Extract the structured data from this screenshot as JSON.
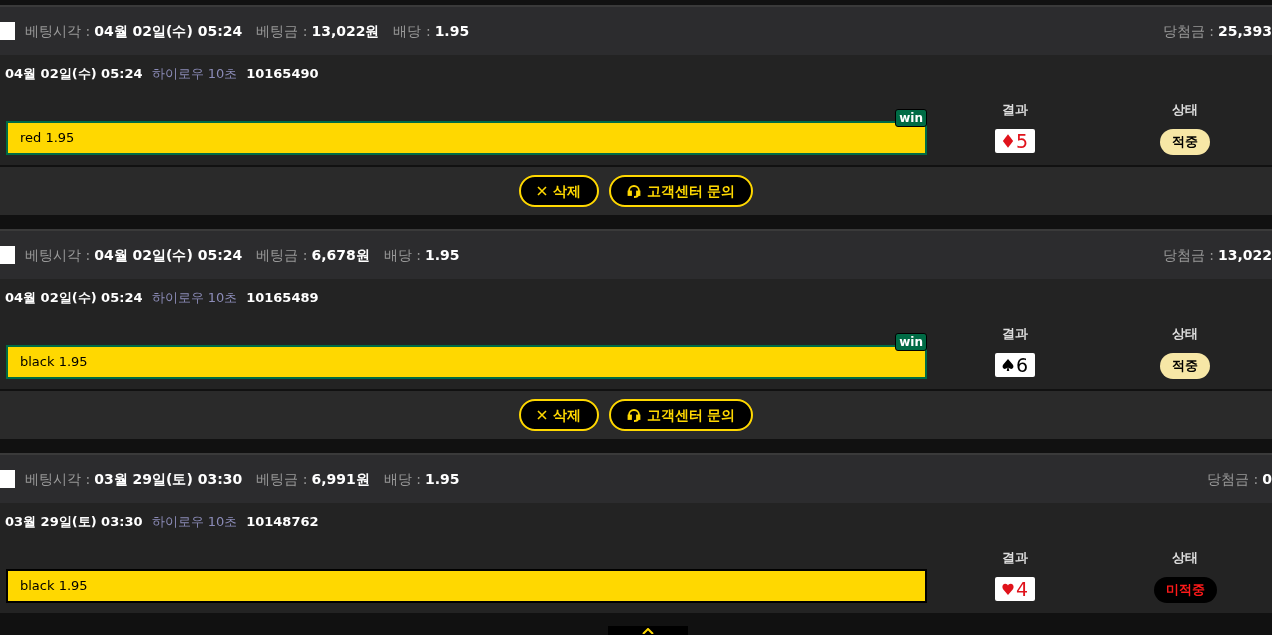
{
  "bets": [
    {
      "checked": false,
      "time_label": "베팅시각 :",
      "time": "04월 02일(수) 05:24",
      "amount_label": "베팅금 :",
      "amount": "13,022원",
      "odds_label": "배당 :",
      "odds": "1.95",
      "payout_label": "당첨금 :",
      "payout": "25,393",
      "date": "04월 02일(수) 05:24",
      "game": "하이로우 10초",
      "round": "10165490",
      "pick": "red 1.95",
      "win": true,
      "badge": "win",
      "result_header": "결과",
      "result": {
        "kind": "diamond",
        "value": "5"
      },
      "status_header": "상태",
      "status": {
        "kind": "hit",
        "label": "적중"
      },
      "buttons": [
        {
          "kind": "delete",
          "label": "삭제"
        },
        {
          "kind": "support",
          "label": "고객센터 문의"
        }
      ]
    },
    {
      "checked": false,
      "time_label": "베팅시각 :",
      "time": "04월 02일(수) 05:24",
      "amount_label": "베팅금 :",
      "amount": "6,678원",
      "odds_label": "배당 :",
      "odds": "1.95",
      "payout_label": "당첨금 :",
      "payout": "13,022",
      "date": "04월 02일(수) 05:24",
      "game": "하이로우 10초",
      "round": "10165489",
      "pick": "black 1.95",
      "win": true,
      "badge": "win",
      "result_header": "결과",
      "result": {
        "kind": "spade",
        "value": "6"
      },
      "status_header": "상태",
      "status": {
        "kind": "hit",
        "label": "적중"
      },
      "buttons": [
        {
          "kind": "delete",
          "label": "삭제"
        },
        {
          "kind": "support",
          "label": "고객센터 문의"
        }
      ]
    },
    {
      "checked": false,
      "time_label": "베팅시각 :",
      "time": "03월 29일(토) 03:30",
      "amount_label": "베팅금 :",
      "amount": "6,991원",
      "odds_label": "배당 :",
      "odds": "1.95",
      "payout_label": "당첨금 :",
      "payout": "0",
      "date": "03월 29일(토) 03:30",
      "game": "하이로우 10초",
      "round": "10148762",
      "pick": "black 1.95",
      "win": false,
      "result_header": "결과",
      "result": {
        "kind": "heart",
        "value": "4"
      },
      "status_header": "상태",
      "status": {
        "kind": "miss",
        "label": "미적중"
      }
    }
  ]
}
